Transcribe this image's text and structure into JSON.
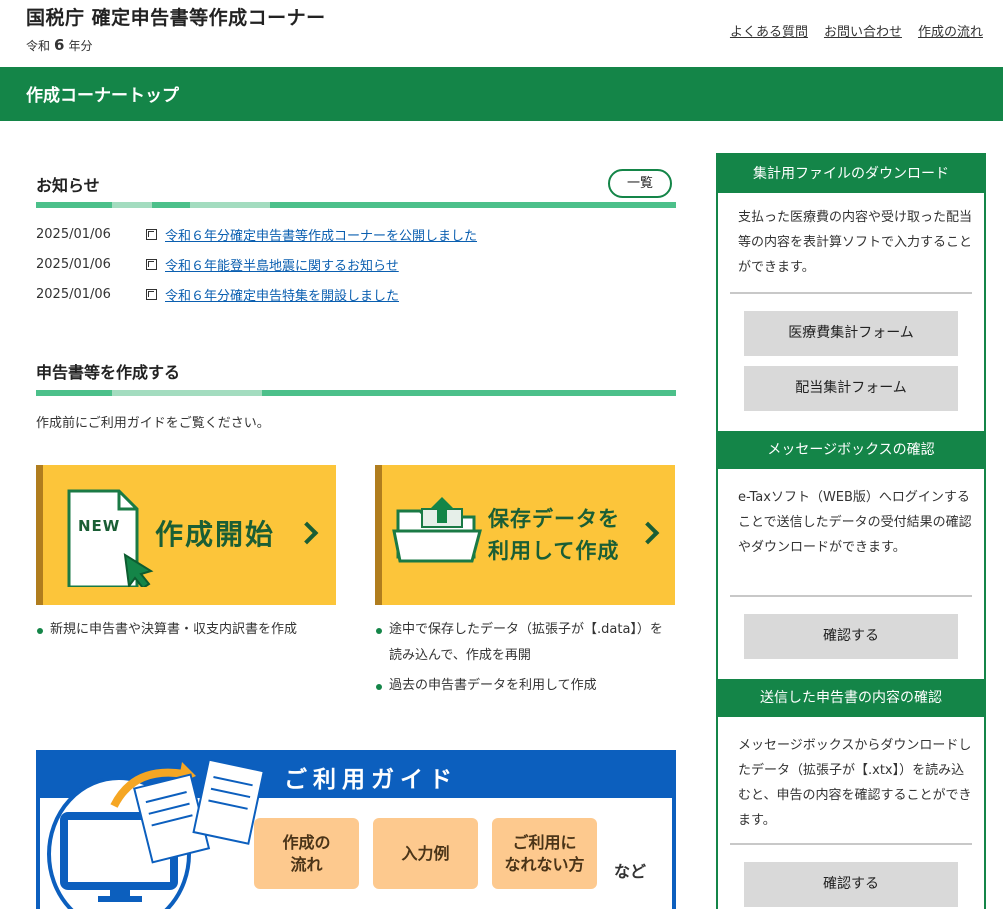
{
  "header": {
    "site_title": "国税庁 確定申告書等作成コーナー",
    "year_prefix": "令和",
    "year_num": "6",
    "year_suffix": "年分",
    "links": [
      "よくある質問",
      "お問い合わせ",
      "作成の流れ"
    ]
  },
  "page_title": "作成コーナートップ",
  "news": {
    "title": "お知らせ",
    "list_button": "一覧",
    "items": [
      {
        "date": "2025/01/06",
        "text": "令和６年分確定申告書等作成コーナーを公開しました"
      },
      {
        "date": "2025/01/06",
        "text": "令和６年能登半島地震に関するお知らせ"
      },
      {
        "date": "2025/01/06",
        "text": "令和６年分確定申告特集を開設しました"
      }
    ]
  },
  "create": {
    "title": "申告書等を作成する",
    "note": "作成前にご利用ガイドをご覧ください。",
    "new_badge": "NEW",
    "start_label": "作成開始",
    "saved_label_1": "保存データを",
    "saved_label_2": "利用して作成",
    "start_bullets": [
      "新規に申告書や決算書・収支内訳書を作成"
    ],
    "saved_bullets": [
      "途中で保存したデータ（拡張子が【.data】）を読み込んで、作成を再開",
      "過去の申告書データを利用して作成"
    ]
  },
  "guide": {
    "title": "ご利用ガイド",
    "chips": [
      {
        "line1": "作成の",
        "line2": "流れ"
      },
      {
        "line1": "入力例",
        "line2": ""
      },
      {
        "line1": "ご利用に",
        "line2": "なれない方"
      }
    ],
    "etc": "など"
  },
  "sidebar": {
    "download": {
      "title": "集計用ファイルのダウンロード",
      "text": "支払った医療費の内容や受け取った配当等の内容を表計算ソフトで入力することができます。",
      "buttons": [
        "医療費集計フォーム",
        "配当集計フォーム"
      ]
    },
    "messagebox": {
      "title": "メッセージボックスの確認",
      "text": "e-Taxソフト（WEB版）へログインすることで送信したデータの受付結果の確認やダウンロードができます。",
      "button": "確認する"
    },
    "sent": {
      "title": "送信した申告書の内容の確認",
      "text": "メッセージボックスからダウンロードしたデータ（拡張子が【.xtx】）を読み込むと、申告の内容を確認することができます。",
      "button": "確認する"
    }
  },
  "colors": {
    "brand_green": "#148548",
    "accent_yellow": "#fcc53a",
    "guide_blue": "#0c5fbe",
    "chip_orange": "#fdc98e",
    "link_blue": "#0b5fb0"
  }
}
